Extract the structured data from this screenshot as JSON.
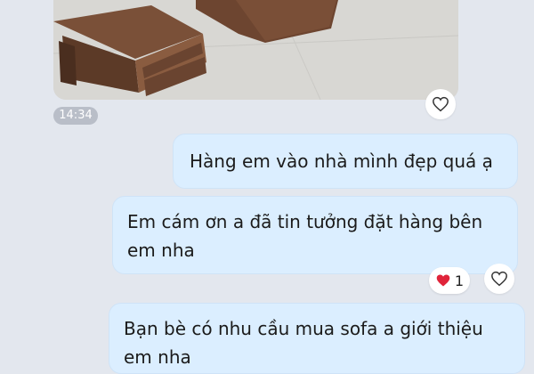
{
  "chat": {
    "image_message": {
      "timestamp": "14:34"
    },
    "messages": [
      {
        "text": "Hàng em vào nhà mình đẹp quá ạ"
      },
      {
        "text": "Em cám ơn a đã tin tưởng đặt hàng bên em nha",
        "reaction_count": "1"
      },
      {
        "text": "Bạn bè có nhu cầu mua sofa a giới thiệu em nha"
      }
    ]
  },
  "icons": {
    "like": "heart-outline-icon",
    "reaction": "red-heart-icon"
  },
  "colors": {
    "background": "#e3e7ee",
    "bubble": "#dbeeff",
    "timestamp_pill": "#b9bec8",
    "heart_red": "#e0243a"
  }
}
